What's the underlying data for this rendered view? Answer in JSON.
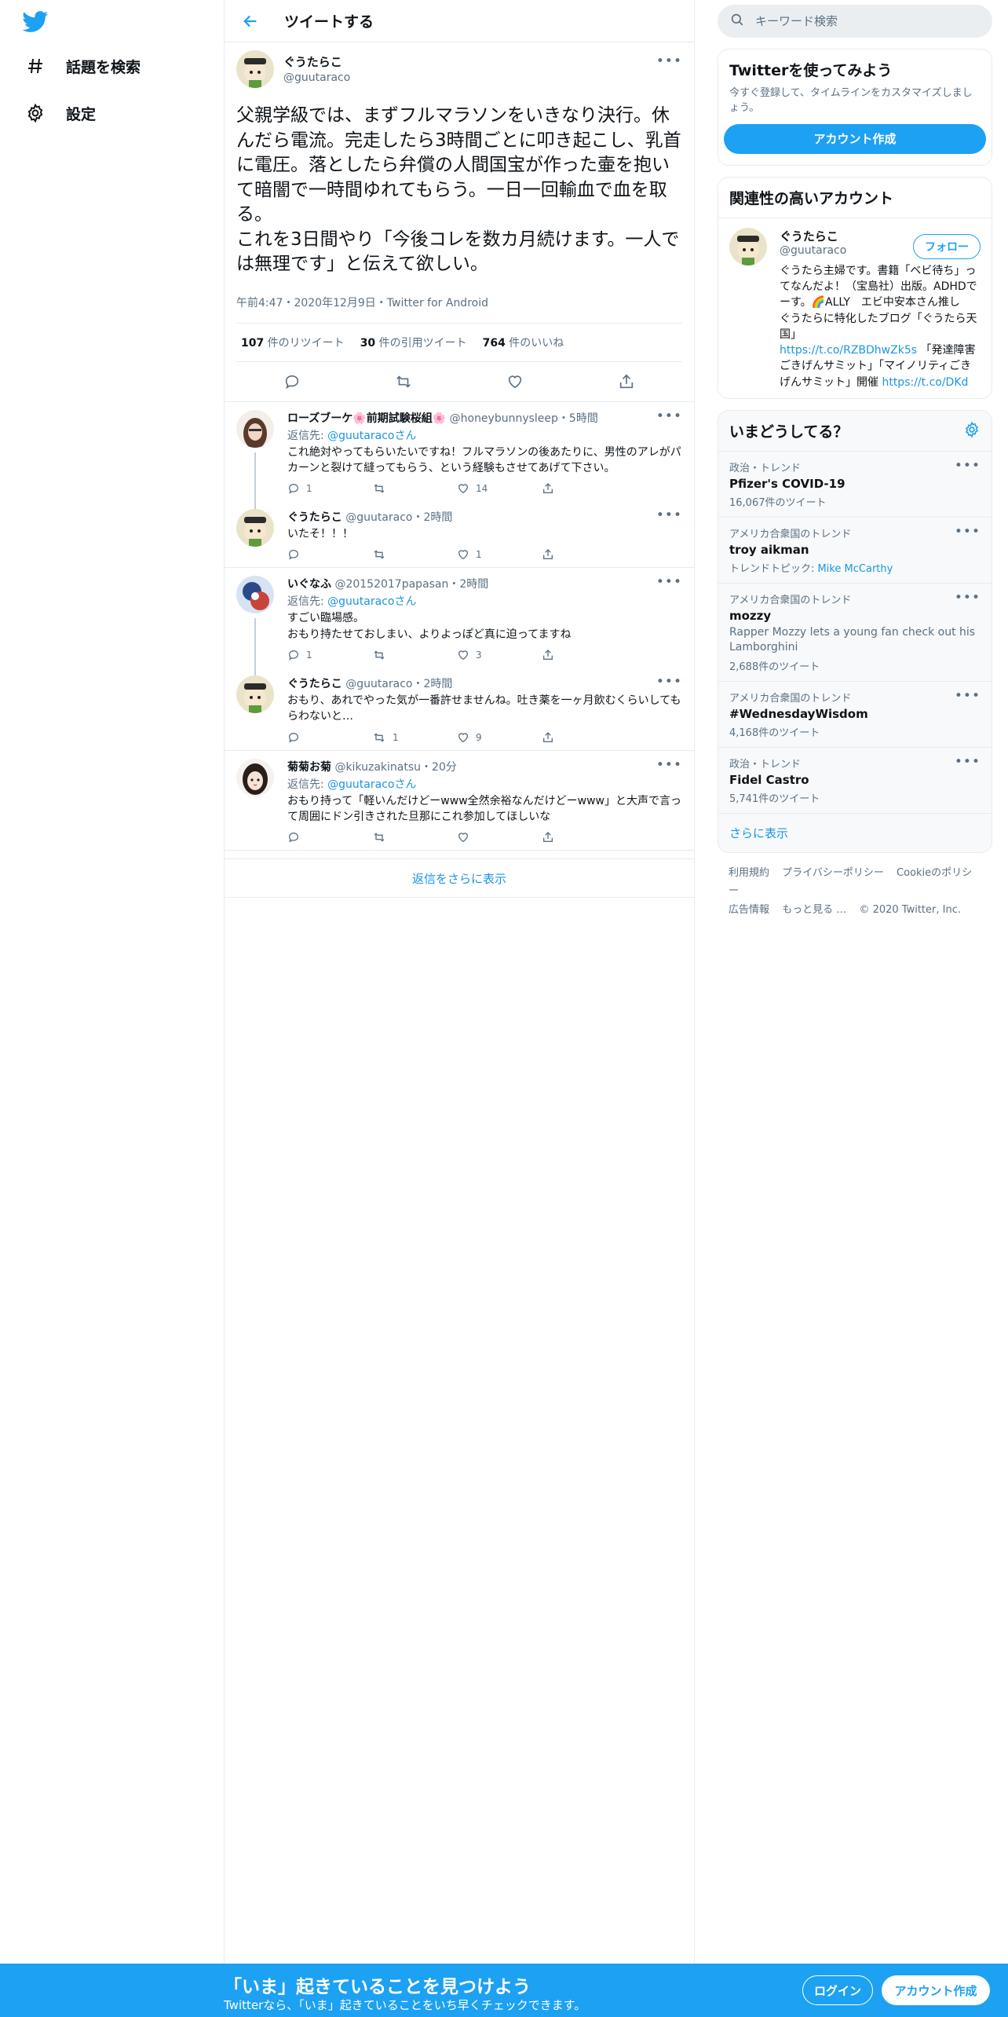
{
  "nav": {
    "logo": "twitter-bird",
    "items": [
      {
        "label": "話題を検索",
        "icon": "hashtag-icon"
      },
      {
        "label": "設定",
        "icon": "gear-icon"
      }
    ]
  },
  "header": {
    "title": "ツイートする"
  },
  "main_tweet": {
    "name": "ぐうたらこ",
    "handle": "@guutaraco",
    "text": "父親学級では、まずフルマラソンをいきなり決行。休んだら電流。完走したら3時間ごとに叩き起こし、乳首に電圧。落としたら弁償の人間国宝が作った壷を抱いて暗闇で一時間ゆれてもらう。一日一回輸血で血を取る。\nこれを3日間やり「今後コレを数カ月続けます。一人では無理です」と伝えて欲しい。",
    "meta": "午前4:47・2020年12月9日・Twitter for Android",
    "stats": [
      {
        "count": "107",
        "label": " 件のリツイート"
      },
      {
        "count": "30",
        "label": " 件の引用ツイート"
      },
      {
        "count": "764",
        "label": " 件のいいね"
      }
    ]
  },
  "replies": [
    {
      "name": "ローズブーケ🌸前期試験桜組🌸",
      "handle": "@honeybunnysleep",
      "time": "・5時間",
      "to_prefix": "返信先: ",
      "to_handle": "@guutaraco",
      "to_suffix": "さん",
      "text": "これ絶対やってもらいたいですね！フルマラソンの後あたりに、男性のアレがパカーンと裂けて縫ってもらう、という経験もさせてあげて下さい。",
      "reply_count": "1",
      "rt_count": "",
      "like_count": "14"
    },
    {
      "name": "ぐうたらこ",
      "handle": "@guutaraco",
      "time": "・2時間",
      "text": "いたそ！！！",
      "reply_count": "",
      "rt_count": "",
      "like_count": "1"
    },
    {
      "name": "いぐなふ",
      "handle": "@20152017papasan",
      "time": "・2時間",
      "to_prefix": "返信先: ",
      "to_handle": "@guutaraco",
      "to_suffix": "さん",
      "text": "すごい臨場感。\nおもり持たせておしまい、よりよっぽど真に迫ってますね",
      "reply_count": "1",
      "rt_count": "",
      "like_count": "3"
    },
    {
      "name": "ぐうたらこ",
      "handle": "@guutaraco",
      "time": "・2時間",
      "text": "おもり、あれでやった気が一番許せませんね。吐き薬を一ヶ月飲むくらいしてもらわないと…",
      "reply_count": "",
      "rt_count": "1",
      "like_count": "9"
    },
    {
      "name": "菊菊お菊",
      "handle": "@kikuzakinatsu",
      "time": "・20分",
      "to_prefix": "返信先: ",
      "to_handle": "@guutaraco",
      "to_suffix": "さん",
      "text": "おもり持って「軽いんだけどーwww全然余裕なんだけどーwww」と大声で言って周囲にドン引きされた旦那にこれ参加してほしいな",
      "reply_count": "",
      "rt_count": "",
      "like_count": ""
    }
  ],
  "show_more_replies": "返信をさらに表示",
  "sidebar": {
    "search_placeholder": "キーワード検索",
    "signup": {
      "title": "Twitterを使ってみよう",
      "subtitle": "今すぐ登録して、タイムラインをカスタマイズしましょう。",
      "button": "アカウント作成"
    },
    "relevant": {
      "title": "関連性の高いアカウント",
      "name": "ぐうたらこ",
      "handle": "@guutaraco",
      "follow": "フォロー",
      "bio_1": "ぐうたら主婦です。書籍「ベビ待ち」ってなんだよ！（宝島社）出版。ADHDでーす。🌈ALLY　エビ中安本さん推し　ぐうたらに特化したブログ「ぐうたら天国」",
      "bio_link1": "https://t.co/RZBDhwZk5s",
      "bio_2": " 「発達障害ごきげんサミット」「マイノリティごきげんサミット」開催 ",
      "bio_link2": "https://t.co/DKd"
    },
    "trends": {
      "title": "いまどうしてる？",
      "items": [
        {
          "context": "政治・トレンド",
          "name": "Pfizer's COVID-19",
          "desc": "",
          "count": "16,067件のツイート"
        },
        {
          "context": "アメリカ合衆国のトレンド",
          "name": "troy aikman",
          "desc": "",
          "topic_label": "トレンドトピック: ",
          "topic": "Mike McCarthy",
          "count": ""
        },
        {
          "context": "アメリカ合衆国のトレンド",
          "name": "mozzy",
          "desc": "Rapper Mozzy lets a young fan check out his Lamborghini",
          "count": "2,688件のツイート"
        },
        {
          "context": "アメリカ合衆国のトレンド",
          "name": "#WednesdayWisdom",
          "desc": "",
          "count": "4,168件のツイート"
        },
        {
          "context": "政治・トレンド",
          "name": "Fidel Castro",
          "desc": "",
          "count": "5,741件のツイート"
        }
      ],
      "show_more": "さらに表示"
    },
    "footer": [
      "利用規約",
      "プライバシーポリシー",
      "Cookieのポリシー",
      "広告情報",
      "もっと見る …",
      "© 2020 Twitter, Inc."
    ]
  },
  "banner": {
    "title": "「いま」起きていることを見つけよう",
    "subtitle": "Twitterなら、「いま」起きていることをいち早くチェックできます。",
    "login": "ログイン",
    "signup": "アカウント作成"
  },
  "colors": {
    "accent": "#1da1f2",
    "link": "#1b95e0",
    "text": "#0f1419",
    "muted": "#5b7083"
  }
}
